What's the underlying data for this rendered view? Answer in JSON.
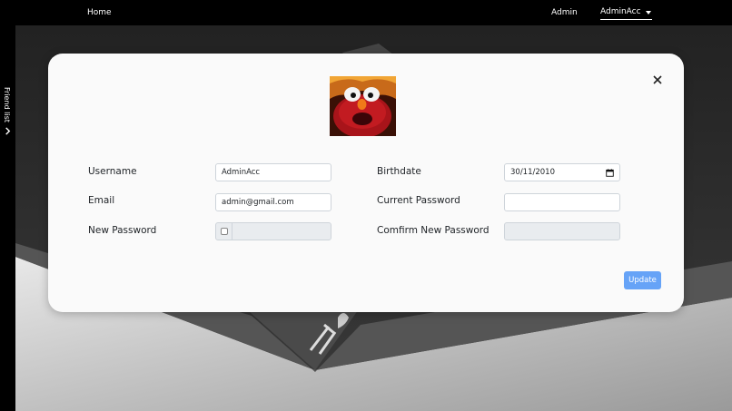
{
  "navbar": {
    "home_label": "Home",
    "admin_label": "Admin",
    "account_label": "AdminAcc"
  },
  "sidebar": {
    "friend_list_label": "Friend list"
  },
  "modal": {
    "fields": {
      "username": {
        "label": "Username",
        "value": "AdminAcc"
      },
      "email": {
        "label": "Email",
        "value": "admin@gmail.com"
      },
      "new_password": {
        "label": "New Password",
        "value": "",
        "checked": false
      },
      "birthdate": {
        "label": "Birthdate",
        "value": "30/11/2010"
      },
      "current_password": {
        "label": "Current Password",
        "value": ""
      },
      "confirm_password": {
        "label": "Comfirm New Password",
        "value": ""
      }
    },
    "update_label": "Update"
  },
  "colors": {
    "navbar_bg": "#000000",
    "modal_bg": "#fafafa",
    "update_button": "#66a3f7"
  },
  "icons": {
    "close": "close-icon",
    "chevron": "chevron-right-icon",
    "caret": "caret-down-icon",
    "calendar": "calendar-icon"
  }
}
